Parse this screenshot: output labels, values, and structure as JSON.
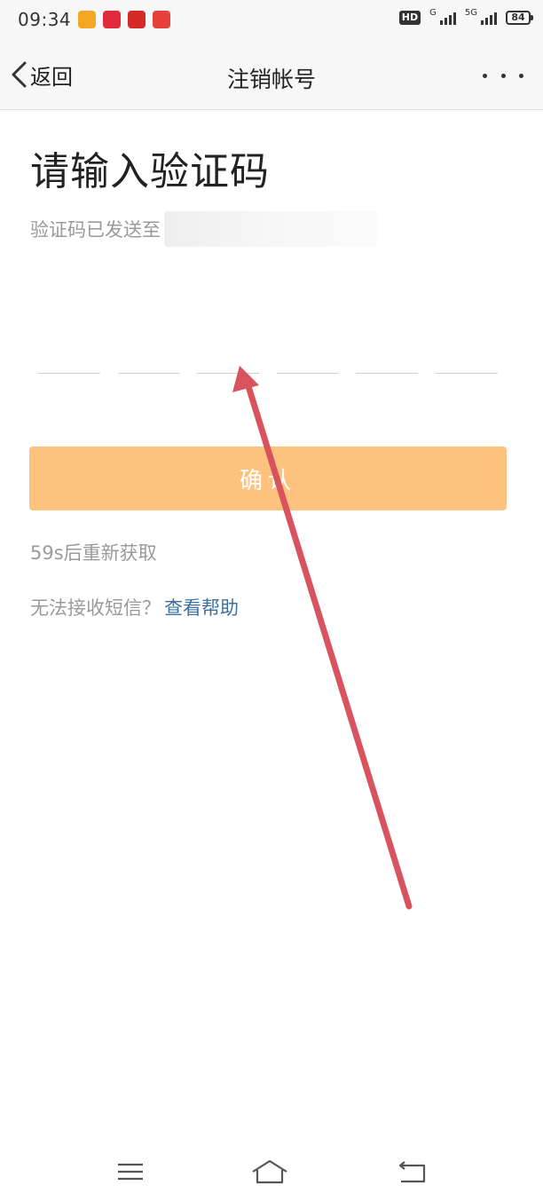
{
  "status_bar": {
    "time": "09:34",
    "app_icons": [
      {
        "name": "weibo-icon",
        "color": "#f5a623"
      },
      {
        "name": "map-pin-app-icon",
        "color": "#e0293b"
      },
      {
        "name": "red-app-icon",
        "color": "#d42a2a"
      },
      {
        "name": "gift-app-icon",
        "color": "#e8403a"
      }
    ],
    "hd_label": "HD",
    "net_1": "G",
    "net_2": "5G",
    "battery": "84"
  },
  "nav": {
    "back_label": "返回",
    "title": "注销帐号"
  },
  "main": {
    "heading": "请输入验证码",
    "sent_hint": "验证码已发送至",
    "code_cells": [
      "",
      "",
      "",
      "",
      "",
      ""
    ],
    "confirm_label": "确认",
    "confirm_color": "#fec27f",
    "resend_text": "59s后重新获取",
    "help_prefix": "无法接收短信？",
    "help_link": "查看帮助",
    "link_color": "#3d6f9f"
  },
  "annotation": {
    "arrow_color": "#d9535e"
  },
  "system_nav": {
    "menu_icon": "menu-icon",
    "home_icon": "home-icon",
    "back_icon": "back-icon"
  }
}
